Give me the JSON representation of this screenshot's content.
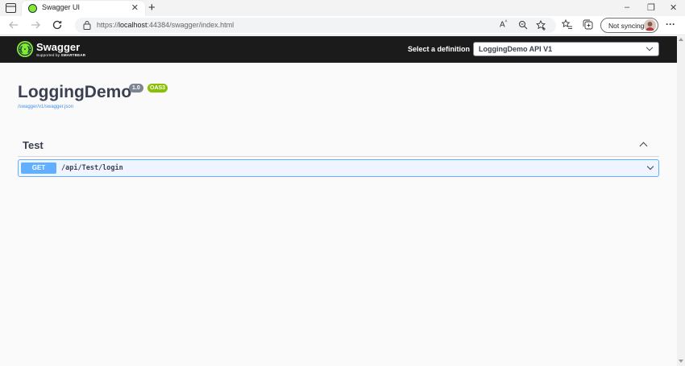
{
  "browser": {
    "tab": {
      "title": "Swagger UI",
      "close_glyph": "✕"
    },
    "new_tab_glyph": "+",
    "window_controls": [
      "–",
      "❐",
      "✕"
    ],
    "address": {
      "scheme": "https://",
      "host": "localhost",
      "rest": ":44384/swagger/index.html"
    },
    "sync": {
      "label": "Not syncing"
    },
    "more_glyph": "···",
    "icons": [
      "sidebar-icon",
      "back-icon",
      "forward-icon",
      "refresh-icon",
      "lock-icon",
      "read-aloud-icon",
      "zoom-icon",
      "add-favorite-icon",
      "favorites-icon",
      "collections-icon",
      "avatar-icon"
    ]
  },
  "swagger": {
    "brand": {
      "name": "Swagger",
      "sub_prefix": "Supported by",
      "sub_brand": "SMARTBEAR"
    },
    "definition": {
      "label": "Select a definition",
      "selected": "LoggingDemo API V1"
    },
    "info": {
      "title": "LoggingDemo",
      "version": "1.0",
      "oas": "OAS3",
      "spec_url": "/swagger/v1/swagger.json"
    },
    "tags": [
      {
        "name": "Test",
        "operations": [
          {
            "method": "GET",
            "path": "/api/Test/login"
          }
        ]
      }
    ]
  },
  "colors": {
    "topbar": "#1b1b1b",
    "swagger_green": "#85ea2d",
    "get_blue": "#61affe",
    "oas_green": "#89bf04",
    "text": "#3b4151"
  }
}
